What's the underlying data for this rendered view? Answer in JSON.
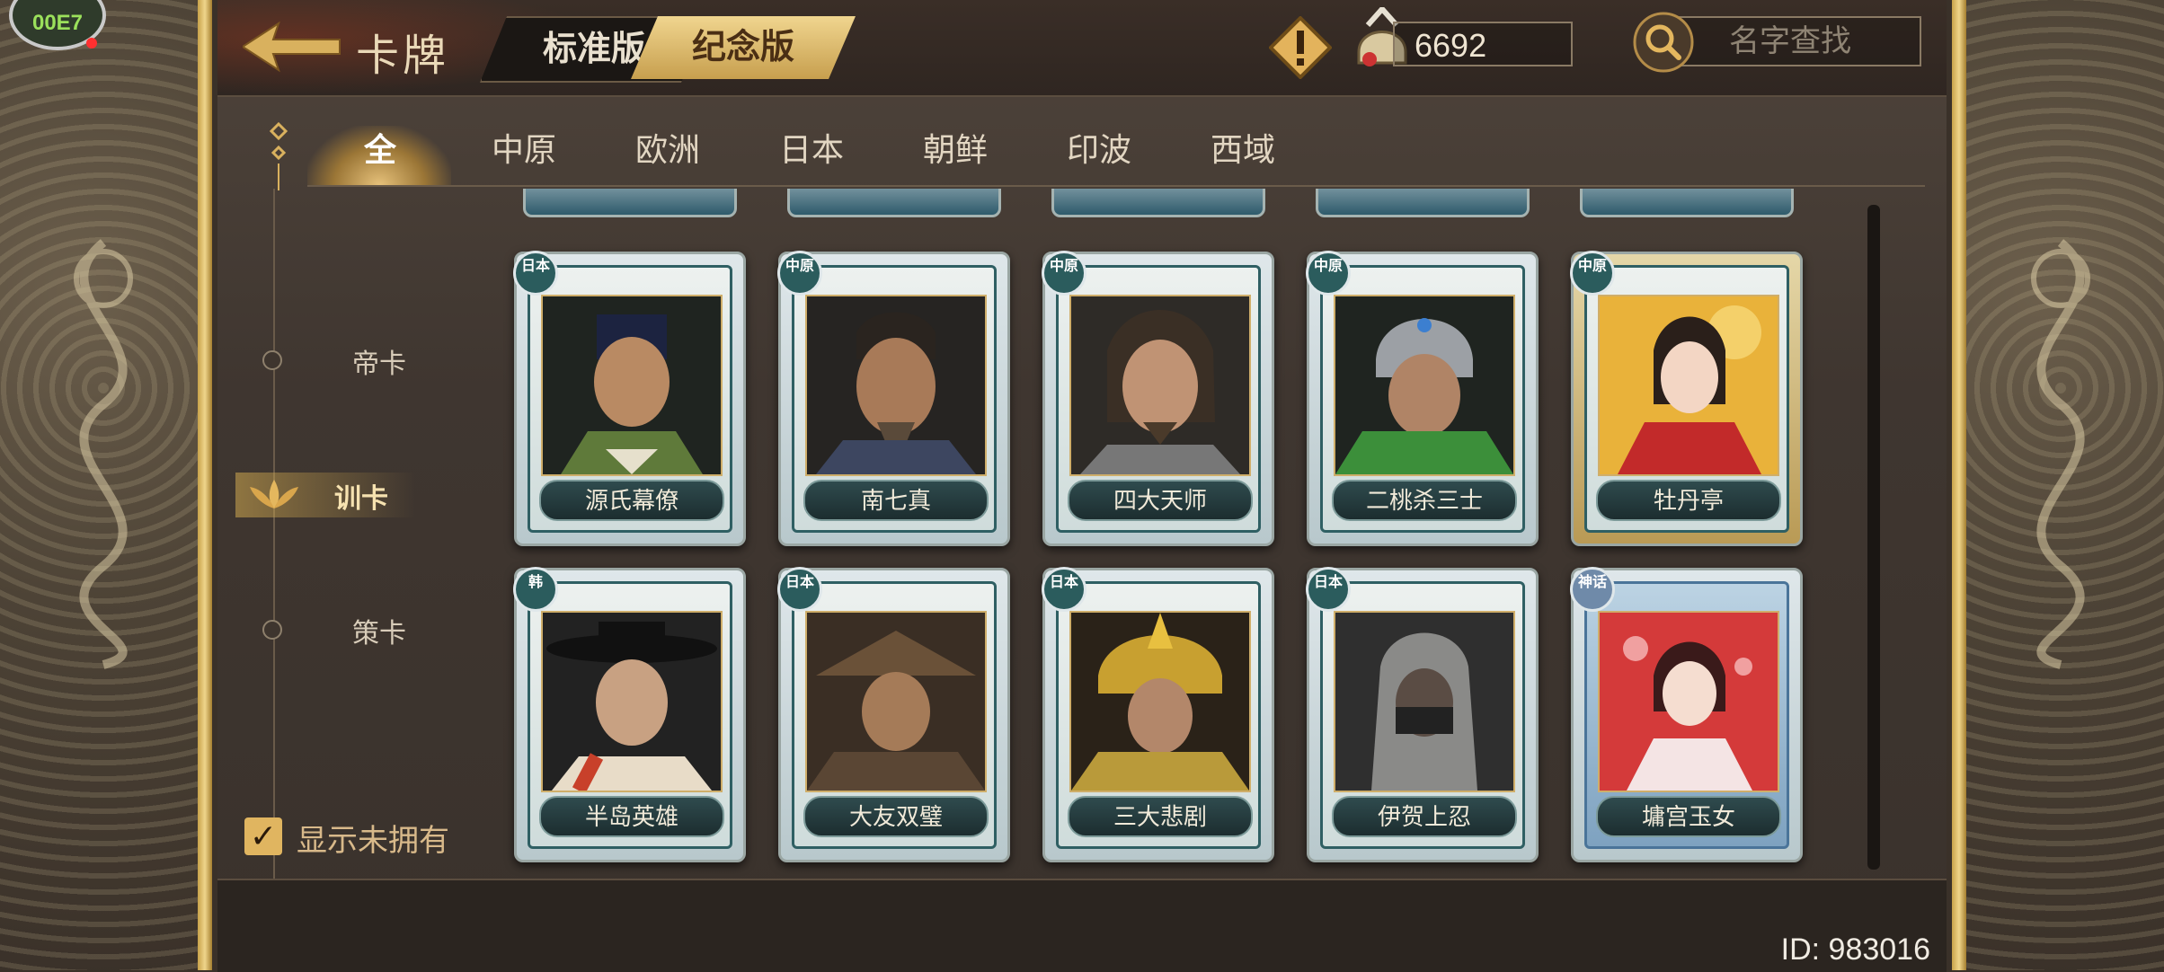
{
  "overlay_badge": {
    "text": "00E7"
  },
  "header": {
    "title": "卡牌",
    "version_tabs": [
      {
        "label": "标准版",
        "active": false
      },
      {
        "label": "纪念版",
        "active": true
      }
    ],
    "currency_amount": "6692",
    "search_placeholder": "名字查找"
  },
  "region_tabs": [
    {
      "label": "全",
      "active": true
    },
    {
      "label": "中原"
    },
    {
      "label": "欧洲"
    },
    {
      "label": "日本"
    },
    {
      "label": "朝鲜"
    },
    {
      "label": "印波"
    },
    {
      "label": "西域"
    }
  ],
  "categories": [
    {
      "label": "帝卡",
      "active": false
    },
    {
      "label": "训卡",
      "active": true
    },
    {
      "label": "策卡",
      "active": false
    }
  ],
  "show_unowned": {
    "label": "显示未拥有",
    "checked": true
  },
  "cards": [
    {
      "name": "源氏幕僚",
      "region": "日本"
    },
    {
      "name": "南七真",
      "region": "中原"
    },
    {
      "name": "四大天师",
      "region": "中原"
    },
    {
      "name": "二桃杀三士",
      "region": "中原"
    },
    {
      "name": "牡丹亭",
      "region": "中原"
    },
    {
      "name": "半岛英雄",
      "region": "韩"
    },
    {
      "name": "大友双璧",
      "region": "日本"
    },
    {
      "name": "三大悲剧",
      "region": "日本"
    },
    {
      "name": "伊贺上忍",
      "region": "日本"
    },
    {
      "name": "墉宫玉女",
      "region": "神话"
    }
  ],
  "footer": {
    "user_id": "ID: 983016"
  },
  "colors": {
    "accent_gold": "#e0b560",
    "panel": "#3f3630",
    "card_teal": "#2f5f63"
  }
}
